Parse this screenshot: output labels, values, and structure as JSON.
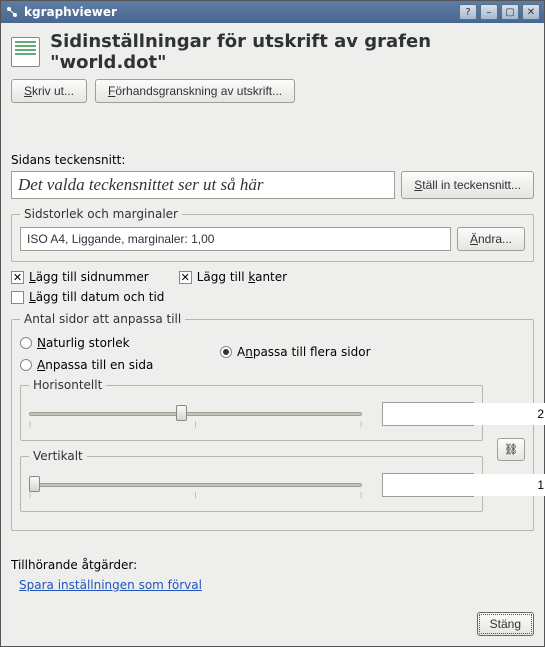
{
  "titlebar": {
    "title": "kgraphviewer"
  },
  "heading": "Sidinställningar för utskrift av grafen \"world.dot\"",
  "buttons": {
    "print": "Skriv ut...",
    "preview": "Förhandsgranskning av utskrift...",
    "set_font": "Ställ in teckensnitt...",
    "change": "Ändra...",
    "close": "Stäng"
  },
  "labels": {
    "page_font": "Sidans teckensnitt:",
    "font_preview": "Det valda teckensnittet ser ut så här",
    "page_size_group": "Sidstorlek och marginaler",
    "page_size_value": "ISO A4, Liggande, marginaler: 1,00",
    "add_pagenum": "Lägg till sidnummer",
    "add_borders": "Lägg till kanter",
    "add_datetime": "Lägg till datum och tid",
    "fit_group": "Antal sidor att anpassa till",
    "natural": "Naturlig storlek",
    "fit_one": "Anpassa till en sida",
    "fit_many": "Anpassa till flera sidor",
    "horizontal": "Horisontellt",
    "vertical": "Vertikalt",
    "related": "Tillhörande åtgärder:",
    "save_default": "Spara inställningen som förval"
  },
  "values": {
    "horizontal": "2",
    "vertical": "1"
  },
  "state": {
    "pagenum_checked": true,
    "borders_checked": true,
    "datetime_checked": false,
    "fit_selected": "many"
  }
}
